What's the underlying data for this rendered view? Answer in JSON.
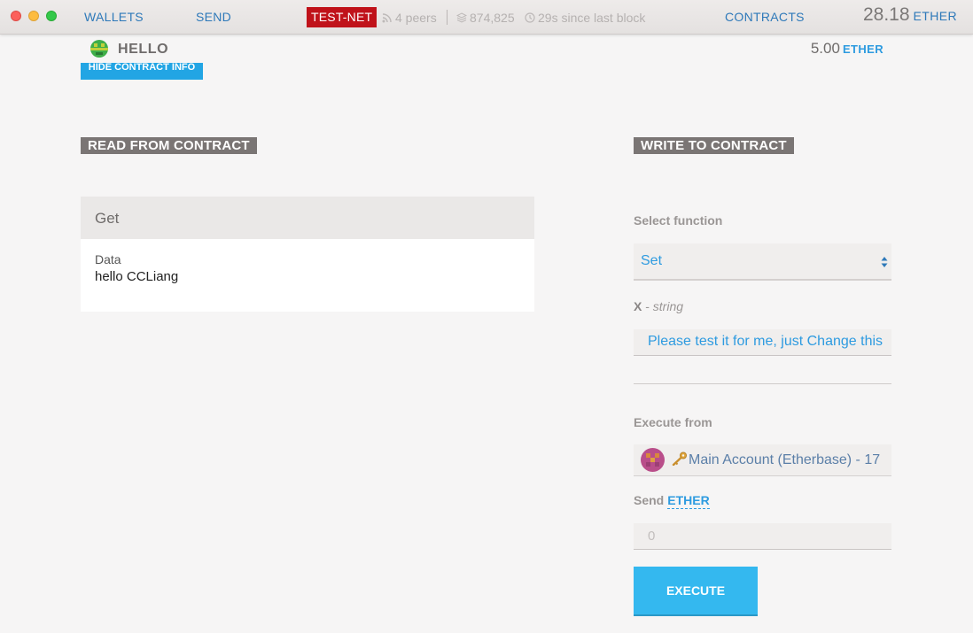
{
  "titlebar": {
    "nav": {
      "wallets": "WALLETS",
      "send": "SEND",
      "contracts": "CONTRACTS"
    },
    "network_badge": "TEST-NET",
    "peers": "4 peers",
    "block_number": "874,825",
    "last_block": "29s since last block",
    "balance": {
      "amount": "28.18",
      "unit": "ETHER"
    }
  },
  "contract": {
    "name": "HELLO",
    "balance": {
      "amount": "5.00",
      "unit": "ETHER"
    },
    "hide_info_button": "HIDE CONTRACT INFO"
  },
  "read": {
    "title": "READ FROM CONTRACT",
    "function_name": "Get",
    "output_label": "Data",
    "output_value": "hello CCLiang"
  },
  "write": {
    "title": "WRITE TO CONTRACT",
    "select_label": "Select function",
    "selected_function": "Set",
    "param_name": "X",
    "param_sep": " - ",
    "param_type": "string",
    "param_value": "Please test it for me, just Change this",
    "execute_from_label": "Execute from",
    "account": "Main Account (Etherbase) - 17",
    "send_label": "Send",
    "send_unit": "ETHER",
    "amount_value": "0",
    "execute_button": "EXECUTE"
  },
  "colors": {
    "accent": "#2e9be0",
    "nav_link": "#2e79b9",
    "testnet_badge": "#c0121a",
    "execute_button": "#34b8ef",
    "section_heading": "#7a7574"
  },
  "icons": [
    "close-window-icon",
    "minimize-window-icon",
    "zoom-window-icon",
    "peers-signal-icon",
    "blocks-layers-icon",
    "clock-icon",
    "contract-identicon",
    "select-arrows-icon",
    "account-identicon",
    "key-icon"
  ]
}
